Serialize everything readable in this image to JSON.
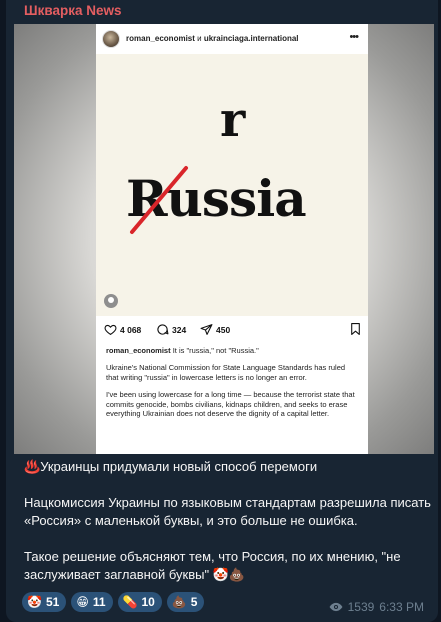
{
  "channel": {
    "name": "Шкварка News",
    "name_color": "#e45e61"
  },
  "media": {
    "post_header": {
      "handle_primary": "roman_economist",
      "connector": " и ",
      "handle_secondary": "ukrainciaga.international"
    },
    "image_text": {
      "lower_r": "r",
      "word": "Russia"
    },
    "actions": {
      "likes": "4 068",
      "comments": "324",
      "shares": "450"
    },
    "caption": {
      "user": "roman_economist",
      "line1": " It is \"russia,\" not \"Russia.\"",
      "para2": "Ukraine's National Commission for State Language Standards has ruled that writing \"russia\" in lowercase letters is no longer an error.",
      "para3": "I've been using lowercase for a long time — because the terrorist state that commits genocide, bombs civilians, kidnaps children, and seeks to erase everything Ukrainian does not deserve the dignity of a capital letter."
    }
  },
  "message": {
    "p1_emoji": "♨️",
    "p1": "Украинцы придумали новый способ перемоги",
    "p2": "Нацкомиссия Украины по языковым стандартам разрешила писать «Россия» с маленькой буквы, и это больше не ошибка.",
    "p3": "Такое решение объясняют тем, что Россия, по их мнению, \"не заслуживает заглавной буквы\" 🤡💩"
  },
  "reactions": [
    {
      "emoji": "🤡",
      "count": "51"
    },
    {
      "emoji": "😁",
      "count": "11"
    },
    {
      "emoji": "💊",
      "count": "10"
    },
    {
      "emoji": "💩",
      "count": "5"
    }
  ],
  "meta": {
    "views": "1539",
    "time": "6:33 PM"
  }
}
